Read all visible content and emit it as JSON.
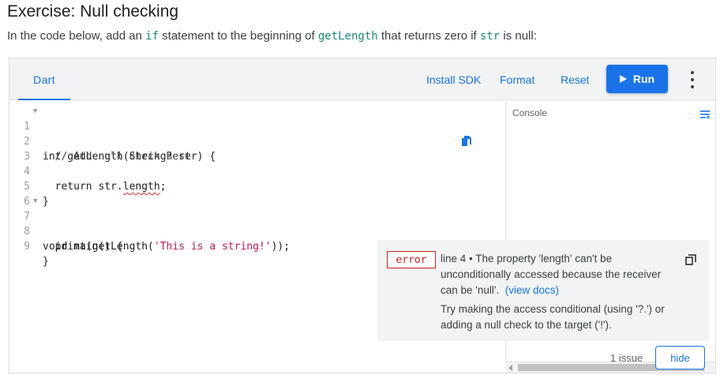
{
  "header": {
    "title": "Exercise: Null checking",
    "intro_before": "In the code below, add an ",
    "intro_code1": "if",
    "intro_mid": " statement to the beginning of ",
    "intro_code2": "getLength",
    "intro_mid2": " that returns zero if ",
    "intro_code3": "str",
    "intro_end": " is null:"
  },
  "toolbar": {
    "tab_label": "Dart",
    "install_sdk_label": "Install SDK",
    "format_label": "Format",
    "reset_label": "Reset",
    "run_label": "Run"
  },
  "editor": {
    "line_numbers": [
      "1",
      "2",
      "3",
      "4",
      "5",
      "6",
      "7",
      "8",
      "9"
    ],
    "lines": {
      "l1": "int getLength(String? str) {",
      "l2": "  // Add null check here",
      "l3": "",
      "l4_pre": "  return str.",
      "l4_err": "length",
      "l4_post": ";",
      "l5": "}",
      "l6": "",
      "l7": "void main() {",
      "l8_pre": "  print(getLength(",
      "l8_str": "'This is a string!'",
      "l8_post": "));",
      "l9": "}"
    }
  },
  "console": {
    "label": "Console"
  },
  "issues": {
    "badge": "error",
    "message": "line 4 • The property 'length' can't be unconditionally accessed because the receiver can be 'null'.",
    "docs_link": "(view docs)",
    "hint": "Try making the access conditional (using '?.') or adding a null check to the target ('!').",
    "count_label": "1 issue",
    "hide_label": "hide"
  },
  "colors": {
    "accent": "#1a73e8",
    "error": "#c5221f",
    "string": "#c2185b"
  }
}
